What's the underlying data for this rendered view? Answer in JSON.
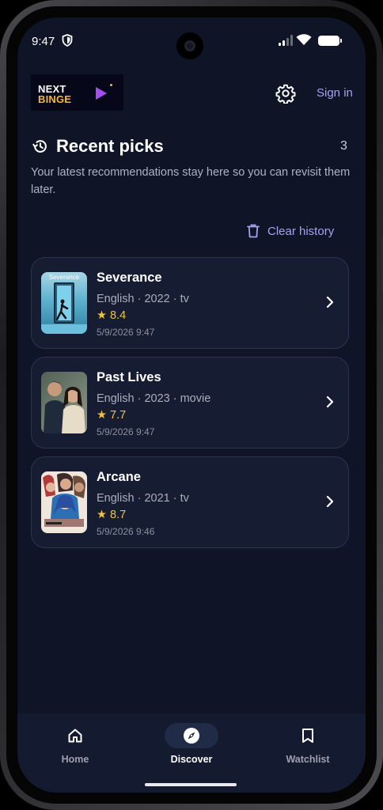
{
  "status_bar": {
    "time": "9:47"
  },
  "app": {
    "logo_line1": "NEXT",
    "logo_line2": "BINGE",
    "sign_in": "Sign in"
  },
  "section": {
    "title": "Recent picks",
    "count": "3",
    "subtitle": "Your latest recommendations stay here so you can revisit them later.",
    "clear_label": "Clear history",
    "poster_caption": "Severance"
  },
  "picks": [
    {
      "title": "Severance",
      "meta": "English · 2022 · tv",
      "rating": "★ 8.4",
      "date": "5/9/2026 9:47"
    },
    {
      "title": "Past Lives",
      "meta": "English · 2023 · movie",
      "rating": "★ 7.7",
      "date": "5/9/2026 9:47"
    },
    {
      "title": "Arcane",
      "meta": "English · 2021 · tv",
      "rating": "★ 8.7",
      "date": "5/9/2026 9:46"
    }
  ],
  "nav": [
    {
      "label": "Home",
      "icon": "home-icon",
      "active": false
    },
    {
      "label": "Discover",
      "icon": "compass-icon",
      "active": true
    },
    {
      "label": "Watchlist",
      "icon": "bookmark-icon",
      "active": false
    }
  ],
  "colors": {
    "background": "#0f1527",
    "card": "#161d33",
    "accent": "#a9a0f2",
    "rating": "#f2c144",
    "logo_gold": "#f5b73b",
    "logo_purple": "#a64df2"
  }
}
